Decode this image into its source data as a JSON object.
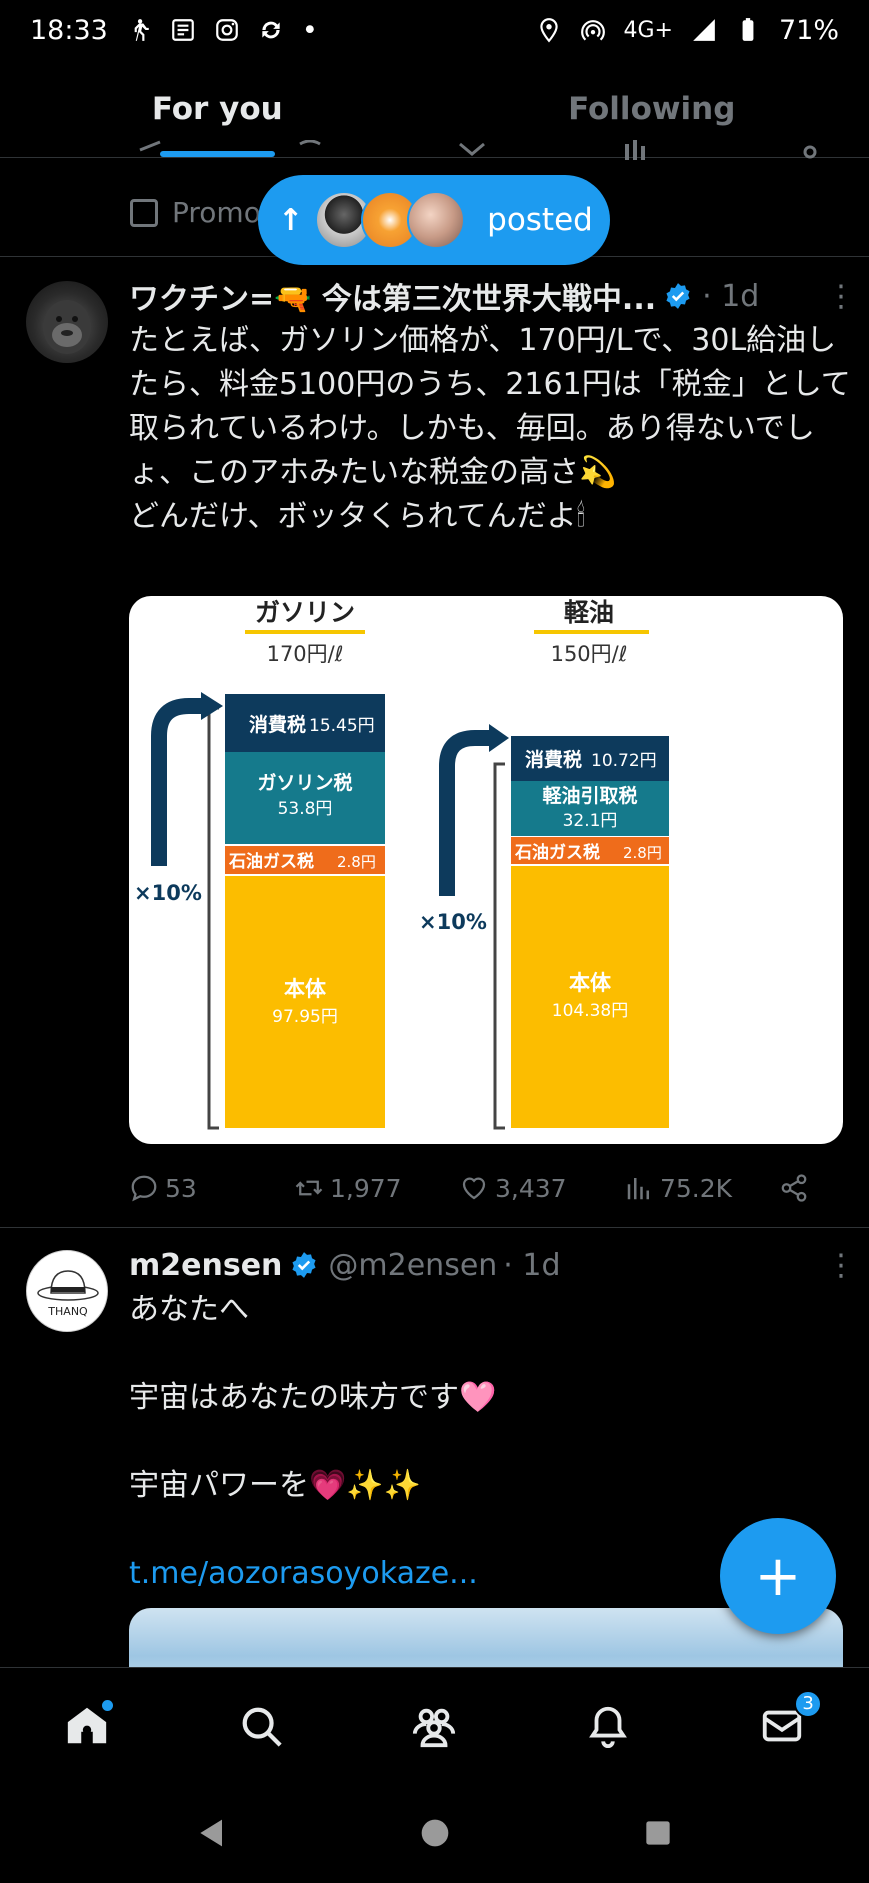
{
  "status_bar": {
    "time": "18:33",
    "dot": "•",
    "network": "4G+",
    "battery": "71%",
    "icons": [
      "walk-icon",
      "news-icon",
      "instagram-icon",
      "sync-icon",
      "location-icon",
      "hotspot-icon",
      "signal-icon",
      "battery-icon"
    ]
  },
  "tabs": [
    {
      "label": "For you",
      "active": true
    },
    {
      "label": "Following",
      "active": false
    }
  ],
  "promo": {
    "label": "Promo"
  },
  "posted_pill": {
    "label": "posted"
  },
  "tweet1": {
    "name": "ワクチン=🔫 今は第三次世界大戦中...",
    "time": "· 1d",
    "text": "たとえば、ガソリン価格が、170円/Lで、30L給油したら、料金5100円のうち、2161円は「税金」として取られているわけ。しかも、毎回。あり得ないでしょ、このアホみたいな税金の高さ💫\nどんだけ、ボッタくられてんだよ🕯",
    "image": {
      "gasoline": {
        "title": "ガソリン",
        "price": "170円/ℓ",
        "consumption_tax": "消費税",
        "consumption_tax_value": "15.45円",
        "fuel_tax": "ガソリン税",
        "fuel_tax_value": "53.8円",
        "oil_gas_tax": "石油ガス税",
        "oil_gas_tax_value": "2.8円",
        "base": "本体",
        "base_value": "97.95円",
        "rate": "×10%"
      },
      "diesel": {
        "title": "軽油",
        "price": "150円/ℓ",
        "consumption_tax": "消費税",
        "consumption_tax_value": "10.72円",
        "fuel_tax": "軽油引取税",
        "fuel_tax_value": "32.1円",
        "oil_gas_tax": "石油ガス税",
        "oil_gas_tax_value": "2.8円",
        "base": "本体",
        "base_value": "104.38円",
        "rate": "×10%"
      },
      "colors": {
        "navy": "#0d3a5c",
        "teal": "#157a8c",
        "orange": "#ef6c1b",
        "yellow": "#fcbd00"
      }
    },
    "stats": {
      "replies": "53",
      "reposts": "1,977",
      "likes": "3,437",
      "views": "75.2K"
    }
  },
  "tweet2": {
    "name": "m2ensen",
    "handle": "@m2ensen",
    "time": "· 1d",
    "avatar_text": "THANQ",
    "line1": "あなたへ",
    "line2": "宇宙はあなたの味方です🩷",
    "line3": "宇宙パワーを💗✨✨",
    "link": "t.me/aozorasoyokaze..."
  },
  "fab": {
    "label": "+"
  },
  "bottom_nav": {
    "items": [
      "home-icon",
      "search-icon",
      "communities-icon",
      "notifications-icon",
      "messages-icon"
    ],
    "messages_badge": "3"
  },
  "accent": "#1d9bf0"
}
